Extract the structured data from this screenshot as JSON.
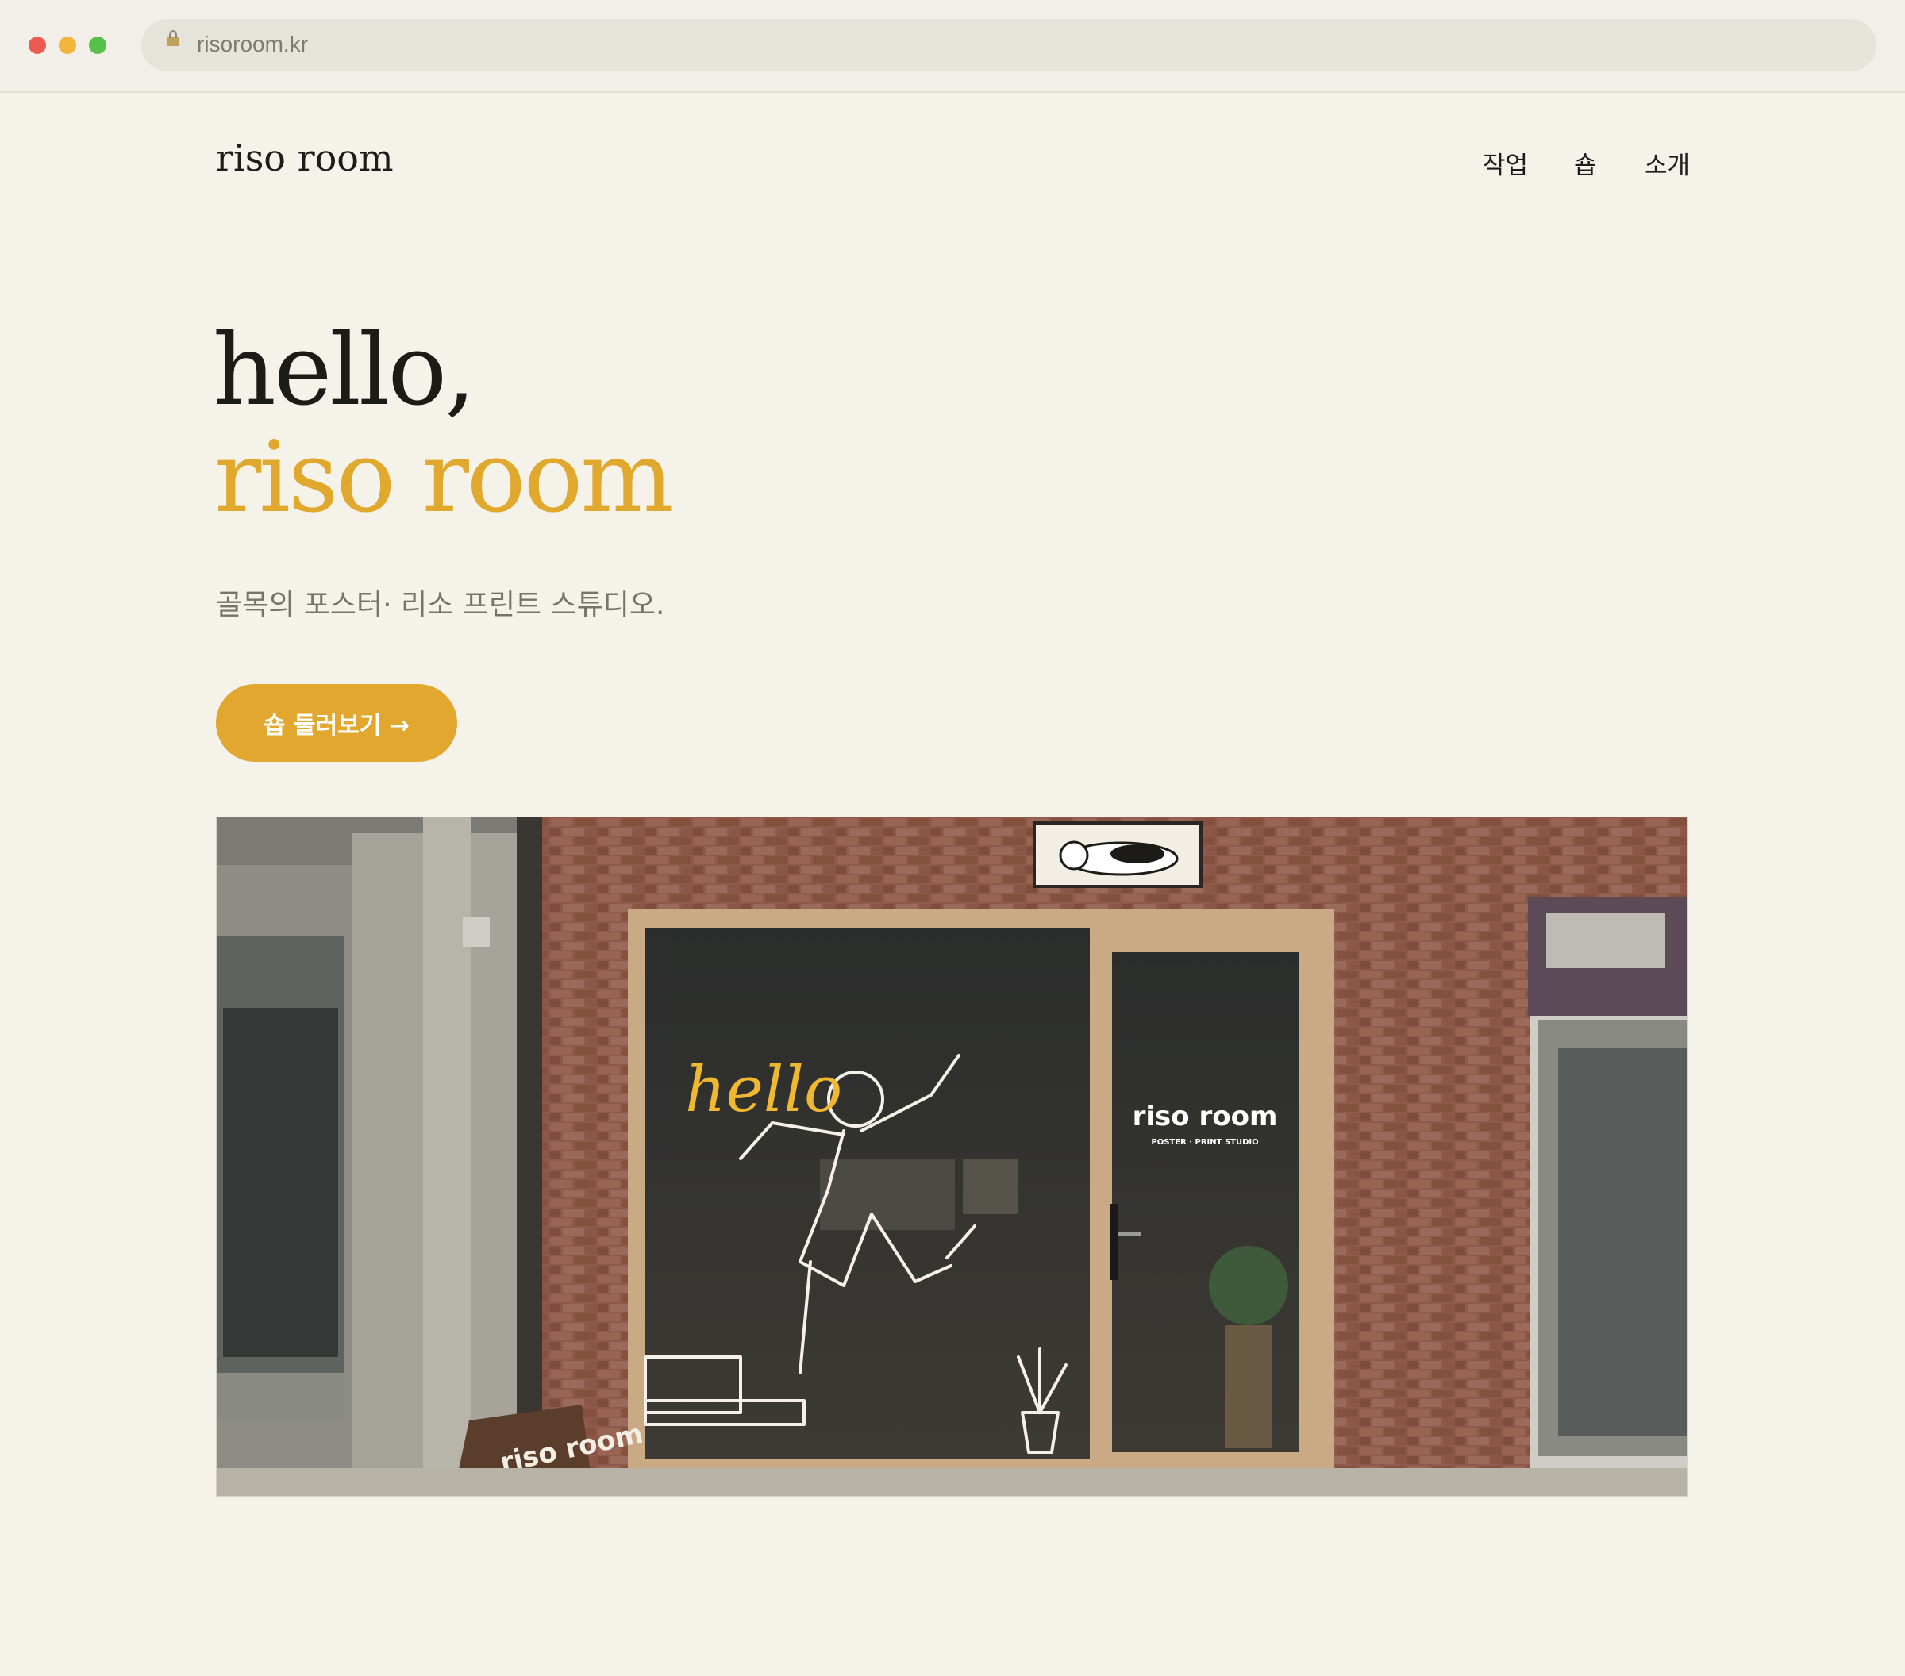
{
  "browser": {
    "url": "risoroom.kr",
    "colors": {
      "close": "#ec5b52",
      "minimize": "#f1b63a",
      "maximize": "#55c04a"
    }
  },
  "site": {
    "logo": "riso room",
    "nav": [
      "작업",
      "숍",
      "소개"
    ]
  },
  "hero": {
    "line1": "hello,",
    "line2": "riso room",
    "tagline": "골목의 포스터· 리소 프린트 스튜디오.",
    "cta_label": "숍 둘러보기 →",
    "accent_color": "#e0a82c"
  },
  "photo": {
    "window_lettering": "hello",
    "door_sign_title": "riso room",
    "door_sign_subtitle": "POSTER · PRINT STUDIO",
    "sandwich_board": "riso room"
  }
}
